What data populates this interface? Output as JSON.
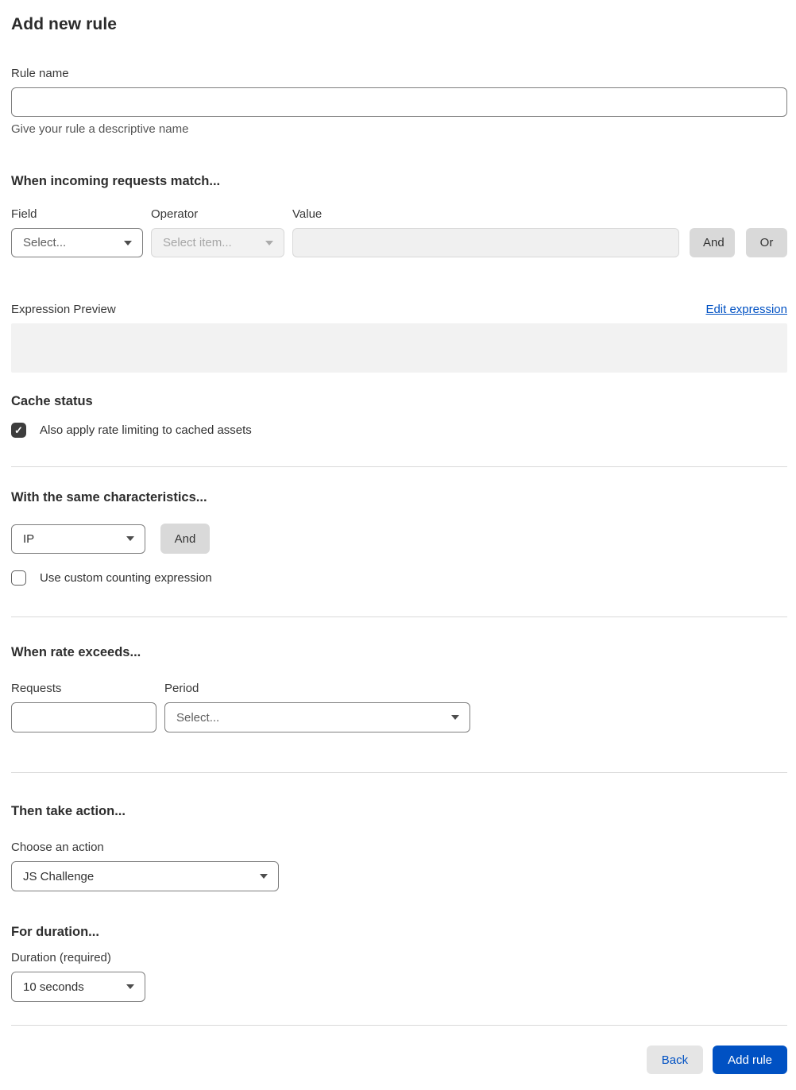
{
  "page": {
    "title": "Add new rule"
  },
  "rule_name": {
    "label": "Rule name",
    "value": "",
    "helper": "Give your rule a descriptive name"
  },
  "match": {
    "heading": "When incoming requests match...",
    "field_label": "Field",
    "field_value": "Select...",
    "operator_label": "Operator",
    "operator_value": "Select item...",
    "value_label": "Value",
    "value_text": "",
    "and_label": "And",
    "or_label": "Or"
  },
  "expression": {
    "label": "Expression Preview",
    "edit_link": "Edit expression",
    "content": ""
  },
  "cache": {
    "heading": "Cache status",
    "checkbox_label": "Also apply rate limiting to cached assets",
    "checked": true
  },
  "characteristics": {
    "heading": "With the same characteristics...",
    "select_value": "IP",
    "and_label": "And",
    "checkbox_label": "Use custom counting expression",
    "checked": false
  },
  "rate": {
    "heading": "When rate exceeds...",
    "requests_label": "Requests",
    "requests_value": "",
    "period_label": "Period",
    "period_value": "Select..."
  },
  "action": {
    "heading": "Then take action...",
    "label": "Choose an action",
    "value": "JS Challenge"
  },
  "duration": {
    "heading": "For duration...",
    "label": "Duration (required)",
    "value": "10 seconds"
  },
  "footer": {
    "back_label": "Back",
    "submit_label": "Add rule"
  },
  "icons": {
    "check": "✓"
  },
  "colors": {
    "accent_blue": "#0051c3",
    "checkbox_checked": "#3d3d3d",
    "divider": "#d9d9d9",
    "disabled_bg": "#f2f2f2"
  }
}
